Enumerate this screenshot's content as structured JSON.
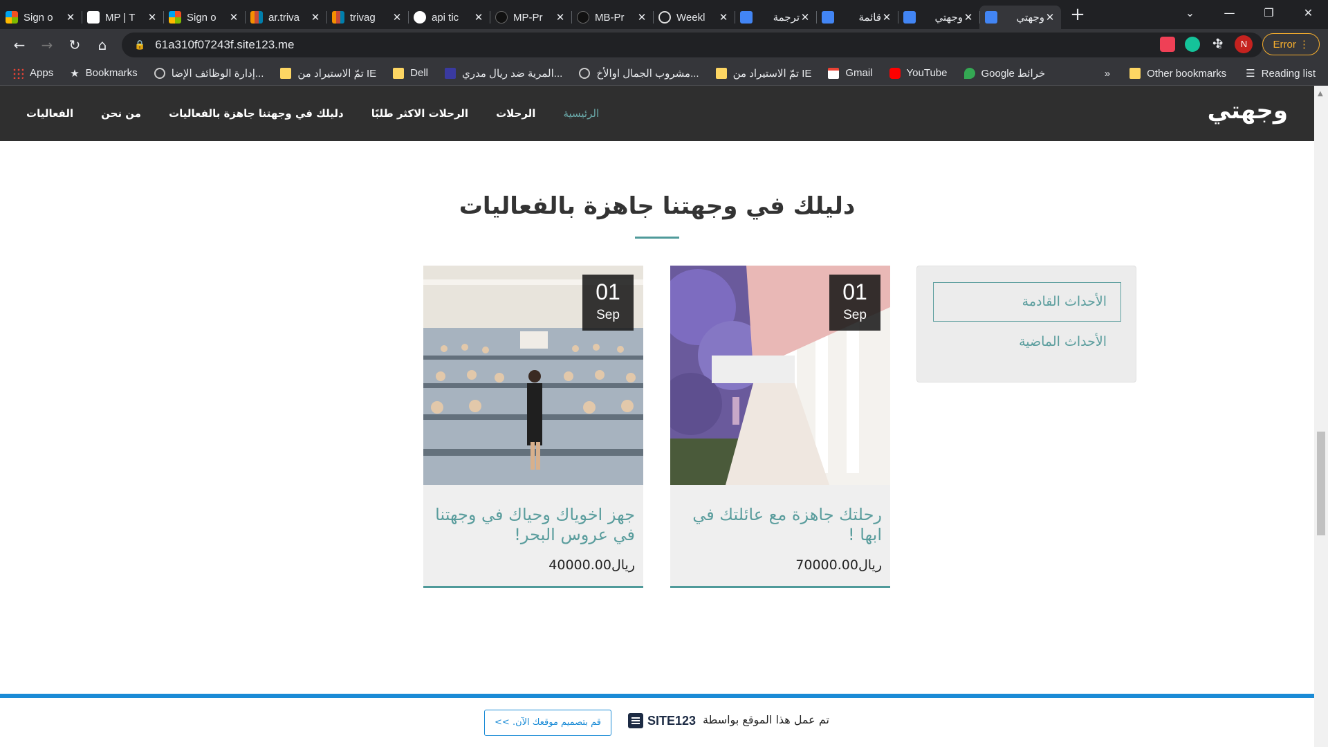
{
  "tabs": [
    {
      "title": "Sign o",
      "icon": "microsoft-icon"
    },
    {
      "title": "MP | T",
      "icon": "trello-icon"
    },
    {
      "title": "Sign o",
      "icon": "microsoft-icon"
    },
    {
      "title": "ar.triva",
      "icon": "trivago-icon"
    },
    {
      "title": "trivag",
      "icon": "trivago-icon"
    },
    {
      "title": "api tic",
      "icon": "google-icon"
    },
    {
      "title": "MP-Pr",
      "icon": "github-icon"
    },
    {
      "title": "MB-Pr",
      "icon": "github-icon"
    },
    {
      "title": "Weekl",
      "icon": "globe-icon"
    },
    {
      "title": "ترجمة",
      "icon": "translate-icon"
    },
    {
      "title": "قائمة",
      "icon": "docs-icon"
    },
    {
      "title": "وجهتي",
      "icon": "docs-icon"
    },
    {
      "title": "وجهتي",
      "icon": "docs-icon"
    }
  ],
  "active_tab_index": 12,
  "address_bar": {
    "url": "61a310f07243f.site123.me"
  },
  "profile": {
    "initial": "N"
  },
  "error_button": "Error",
  "bookmarks": [
    {
      "label": "Apps",
      "icon": "apps-grid-icon"
    },
    {
      "label": "Bookmarks",
      "icon": "star-icon"
    },
    {
      "label": "إدارة الوظائف الإضا...",
      "icon": "globe-icon"
    },
    {
      "label": "تمّ الاستيراد من IE",
      "icon": "folder-icon"
    },
    {
      "label": "Dell",
      "icon": "folder-icon"
    },
    {
      "label": "المرية ضد ريال مدري...",
      "icon": "sports-icon"
    },
    {
      "label": "مشروب الجمال اوالأخ...",
      "icon": "globe-icon"
    },
    {
      "label": "تمّ الاستيراد من IE",
      "icon": "folder-icon"
    },
    {
      "label": "Gmail",
      "icon": "gmail-icon"
    },
    {
      "label": "YouTube",
      "icon": "youtube-icon"
    },
    {
      "label": "Google خرائط",
      "icon": "maps-icon"
    }
  ],
  "bookmarks_right": {
    "overflow": "»",
    "other": "Other bookmarks",
    "reading_list": "Reading list"
  },
  "site": {
    "logo": "وجهتي",
    "menu": [
      {
        "label": "الرئيسية",
        "active": true
      },
      {
        "label": "الرحلات",
        "active": false
      },
      {
        "label": "الرحلات الاكثر طلبًا",
        "active": false
      },
      {
        "label": "دليلك في وجهتنا جاهزة بالفعاليات",
        "active": false
      },
      {
        "label": "من نحن",
        "active": false
      },
      {
        "label": "الفعاليات",
        "active": false
      }
    ]
  },
  "section": {
    "title": "دليلك في وجهتنا جاهزة بالفعاليات",
    "filters": {
      "upcoming": "الأحداث القادمة",
      "past": "الأحداث الماضية"
    }
  },
  "events": [
    {
      "day": "01",
      "month": "Sep",
      "title": "رحلتك جاهزة مع عائلتك في ابها !",
      "price": "ريال70000.00"
    },
    {
      "day": "01",
      "month": "Sep",
      "title": "جهز اخوياك وحياك في وجهتنا في عروس البحر!",
      "price": "ريال40000.00"
    }
  ],
  "footer": {
    "text": "تم عمل هذا الموقع بواسطة",
    "brand": "SITE123",
    "cta": "قم بتصميم موقعك الآن. >>"
  },
  "colors": {
    "accent": "#5a9d9d",
    "header_bg": "#2f2f2f",
    "footer_accent": "#1a8bd6"
  }
}
